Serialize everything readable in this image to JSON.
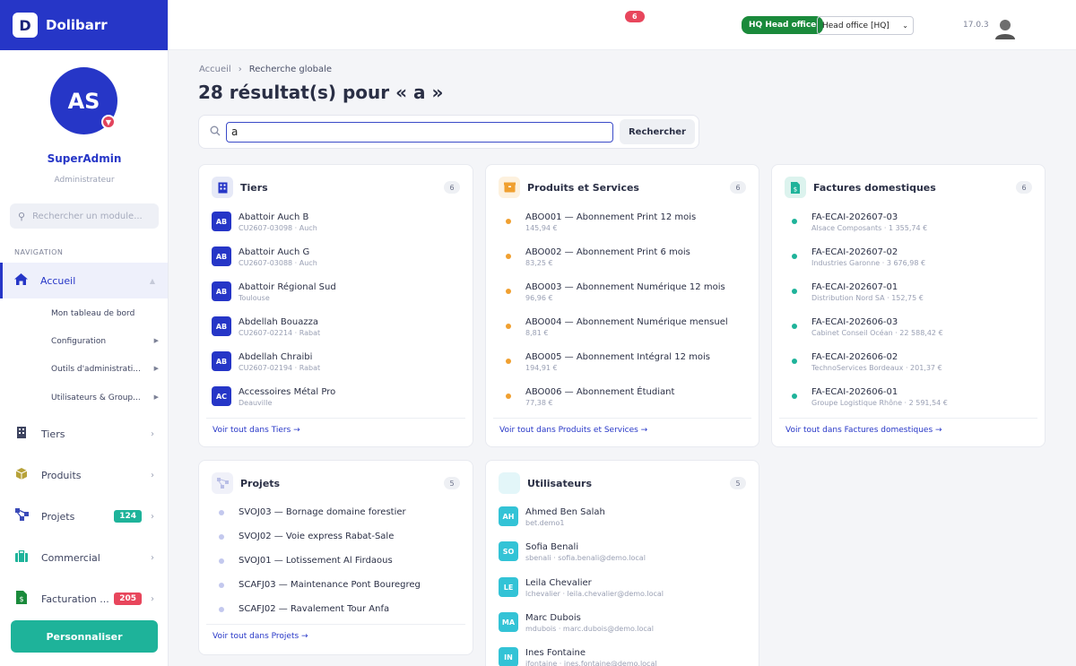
{
  "app": {
    "name": "Dolibarr",
    "logo_letter": "D"
  },
  "user": {
    "initials": "AS",
    "name": "SuperAdmin",
    "role": "Administrateur",
    "badge_icon": "chevron-down-icon"
  },
  "sidebar": {
    "search_placeholder": "Rechercher un module...",
    "nav_title": "NAVIGATION",
    "active": {
      "label": "Accueil",
      "icon": "home-icon"
    },
    "subitems": [
      {
        "label": "Mon tableau de bord",
        "has_chevron": false
      },
      {
        "label": "Configuration",
        "has_chevron": true
      },
      {
        "label": "Outils d'administrati...",
        "has_chevron": true
      },
      {
        "label": "Utilisateurs & Group...",
        "has_chevron": true
      }
    ],
    "items": [
      {
        "label": "Tiers",
        "icon": "building-icon",
        "color": "#3e4460",
        "badge": ""
      },
      {
        "label": "Produits",
        "icon": "box-icon",
        "color": "#b7a23a",
        "badge": ""
      },
      {
        "label": "Projets",
        "icon": "project-icon",
        "color": "#3a4ab8",
        "badge": "124",
        "badge_color": "#1eb39a"
      },
      {
        "label": "Commercial",
        "icon": "briefcase-icon",
        "color": "#1eb39a",
        "badge": ""
      },
      {
        "label": "Facturation ...",
        "icon": "invoice-icon",
        "color": "#1a8a3b",
        "badge": "205",
        "badge_color": "#e8465c"
      }
    ],
    "customize_label": "Personnaliser"
  },
  "topbar": {
    "notifications": "6",
    "entity_pill": "HQ Head office",
    "entity_select": "Head office [HQ]",
    "version": "17.0.3"
  },
  "breadcrumb": {
    "home": "Accueil",
    "current": "Recherche globale"
  },
  "page_title": "28 résultat(s) pour « a »",
  "search": {
    "value": "a",
    "button": "Rechercher"
  },
  "cards": {
    "tiers": {
      "title": "Tiers",
      "count": "6",
      "footer": "Voir tout dans Tiers",
      "rows": [
        {
          "badge": "AB",
          "main": "Abattoir Auch B",
          "sub": "CU2607-03098 · Auch"
        },
        {
          "badge": "AB",
          "main": "Abattoir Auch G",
          "sub": "CU2607-03088 · Auch"
        },
        {
          "badge": "AB",
          "main": "Abattoir Régional Sud",
          "sub": "Toulouse"
        },
        {
          "badge": "AB",
          "main": "Abdellah Bouazza",
          "sub": "CU2607-02214 · Rabat"
        },
        {
          "badge": "AB",
          "main": "Abdellah Chraibi",
          "sub": "CU2607-02194 · Rabat"
        },
        {
          "badge": "AC",
          "main": "Accessoires Métal Pro",
          "sub": "Deauville"
        }
      ]
    },
    "produits": {
      "title": "Produits et Services",
      "count": "6",
      "footer": "Voir tout dans Produits et Services",
      "rows": [
        {
          "main": "ABO001 — Abonnement Print 12 mois",
          "sub": "145,94 €"
        },
        {
          "main": "ABO002 — Abonnement Print 6 mois",
          "sub": "83,25 €"
        },
        {
          "main": "ABO003 — Abonnement Numérique 12 mois",
          "sub": "96,96 €"
        },
        {
          "main": "ABO004 — Abonnement Numérique mensuel",
          "sub": "8,81 €"
        },
        {
          "main": "ABO005 — Abonnement Intégral 12 mois",
          "sub": "194,91 €"
        },
        {
          "main": "ABO006 — Abonnement Étudiant",
          "sub": "77,38 €"
        }
      ]
    },
    "factures": {
      "title": "Factures domestiques",
      "count": "6",
      "footer": "Voir tout dans Factures domestiques",
      "rows": [
        {
          "main": "FA-ECAI-202607-03",
          "sub": "Alsace Composants · 1 355,74 €"
        },
        {
          "main": "FA-ECAI-202607-02",
          "sub": "Industries Garonne · 3 676,98 €"
        },
        {
          "main": "FA-ECAI-202607-01",
          "sub": "Distribution Nord SA · 152,75 €"
        },
        {
          "main": "FA-ECAI-202606-03",
          "sub": "Cabinet Conseil Océan · 22 588,42 €"
        },
        {
          "main": "FA-ECAI-202606-02",
          "sub": "TechnoServices Bordeaux · 201,37 €"
        },
        {
          "main": "FA-ECAI-202606-01",
          "sub": "Groupe Logistique Rhône · 2 591,54 €"
        }
      ]
    },
    "projets": {
      "title": "Projets",
      "count": "5",
      "footer": "Voir tout dans Projets",
      "rows": [
        {
          "main": "SVOJ03 — Bornage domaine forestier"
        },
        {
          "main": "SVOJ02 — Voie express Rabat-Sale"
        },
        {
          "main": "SVOJ01 — Lotissement Al Firdaous"
        },
        {
          "main": "SCAFJ03 — Maintenance Pont Bouregreg"
        },
        {
          "main": "SCAFJ02 — Ravalement Tour Anfa"
        }
      ]
    },
    "utilisateurs": {
      "title": "Utilisateurs",
      "count": "5",
      "rows": [
        {
          "badge": "AH",
          "main": "Ahmed Ben Salah",
          "sub": "bet.demo1"
        },
        {
          "badge": "SO",
          "main": "Sofia Benali",
          "sub": "sbenali · sofia.benali@demo.local"
        },
        {
          "badge": "LE",
          "main": "Leila Chevalier",
          "sub": "lchevalier · leila.chevalier@demo.local"
        },
        {
          "badge": "MA",
          "main": "Marc Dubois",
          "sub": "mdubois · marc.dubois@demo.local"
        },
        {
          "badge": "IN",
          "main": "Ines Fontaine",
          "sub": "ifontaine · ines.fontaine@demo.local"
        }
      ]
    }
  },
  "colors": {
    "brand": "#2636c7",
    "teal": "#1eb39a",
    "orange": "#f0a030",
    "lavender": "#c3c8ee",
    "user_badge": "#33c3d6"
  }
}
